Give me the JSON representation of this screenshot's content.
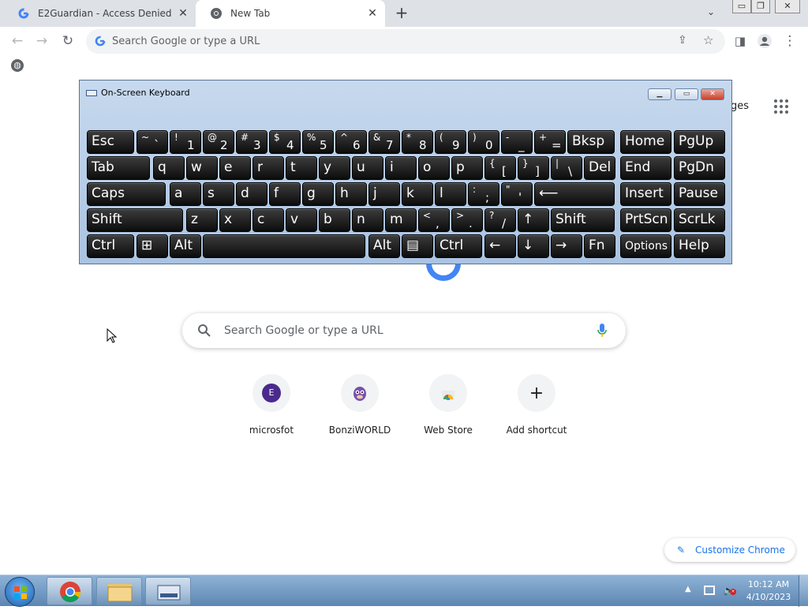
{
  "tabs": [
    {
      "title": "E2Guardian - Access Denied",
      "icon": "google-icon"
    },
    {
      "title": "New Tab",
      "icon": "chrome-icon"
    }
  ],
  "window_controls": {
    "minimize": "▭",
    "restore": "❐",
    "close": "✕"
  },
  "omnibox": {
    "placeholder": "Search Google or type a URL"
  },
  "ntp": {
    "images_link": "ages",
    "search_placeholder": "Search Google or type a URL",
    "shortcuts": [
      {
        "label": "microsfot",
        "letter": "E"
      },
      {
        "label": "BonziWORLD"
      },
      {
        "label": "Web Store"
      },
      {
        "label": "Add shortcut",
        "glyph": "+"
      }
    ],
    "customize": "Customize Chrome"
  },
  "osk": {
    "title": "On-Screen Keyboard",
    "rows": [
      [
        {
          "m": "Esc"
        },
        {
          "s": "~",
          "b": "`"
        },
        {
          "s": "!",
          "b": "1"
        },
        {
          "s": "@",
          "b": "2"
        },
        {
          "s": "#",
          "b": "3"
        },
        {
          "s": "$",
          "b": "4"
        },
        {
          "s": "%",
          "b": "5"
        },
        {
          "s": "^",
          "b": "6"
        },
        {
          "s": "&",
          "b": "7"
        },
        {
          "s": "*",
          "b": "8"
        },
        {
          "s": "(",
          "b": "9"
        },
        {
          "s": ")",
          "b": "0"
        },
        {
          "s": "-",
          "b": "_"
        },
        {
          "s": "+",
          "b": "="
        },
        {
          "m": "Bksp"
        },
        {
          "m": "Home"
        },
        {
          "m": "PgUp"
        }
      ],
      [
        {
          "m": "Tab"
        },
        {
          "m": "q"
        },
        {
          "m": "w"
        },
        {
          "m": "e"
        },
        {
          "m": "r"
        },
        {
          "m": "t"
        },
        {
          "m": "y"
        },
        {
          "m": "u"
        },
        {
          "m": "i"
        },
        {
          "m": "o"
        },
        {
          "m": "p"
        },
        {
          "s": "{",
          "b": "["
        },
        {
          "s": "}",
          "b": "]"
        },
        {
          "s": "|",
          "b": "\\"
        },
        {
          "m": "Del"
        },
        {
          "m": "End"
        },
        {
          "m": "PgDn"
        }
      ],
      [
        {
          "m": "Caps"
        },
        {
          "m": "a"
        },
        {
          "m": "s"
        },
        {
          "m": "d"
        },
        {
          "m": "f"
        },
        {
          "m": "g"
        },
        {
          "m": "h"
        },
        {
          "m": "j"
        },
        {
          "m": "k"
        },
        {
          "m": "l"
        },
        {
          "s": ":",
          "b": ";"
        },
        {
          "s": "\"",
          "b": "'"
        },
        {
          "m": "⟵"
        },
        {
          "m": "Insert"
        },
        {
          "m": "Pause"
        }
      ],
      [
        {
          "m": "Shift"
        },
        {
          "m": "z"
        },
        {
          "m": "x"
        },
        {
          "m": "c"
        },
        {
          "m": "v"
        },
        {
          "m": "b"
        },
        {
          "m": "n"
        },
        {
          "m": "m"
        },
        {
          "s": "<",
          "b": ","
        },
        {
          "s": ">",
          "b": "."
        },
        {
          "s": "?",
          "b": "/"
        },
        {
          "m": "↑"
        },
        {
          "m": "Shift"
        },
        {
          "m": "PrtScn"
        },
        {
          "m": "ScrLk"
        }
      ],
      [
        {
          "m": "Ctrl"
        },
        {
          "m": "⊞"
        },
        {
          "m": "Alt"
        },
        {
          "m": ""
        },
        {
          "m": "Alt"
        },
        {
          "m": "▤"
        },
        {
          "m": "Ctrl"
        },
        {
          "m": "←"
        },
        {
          "m": "↓"
        },
        {
          "m": "→"
        },
        {
          "m": "Fn"
        },
        {
          "m": "Options"
        },
        {
          "m": "Help"
        }
      ]
    ]
  },
  "taskbar": {
    "time": "10:12 AM",
    "date": "4/10/2023"
  }
}
